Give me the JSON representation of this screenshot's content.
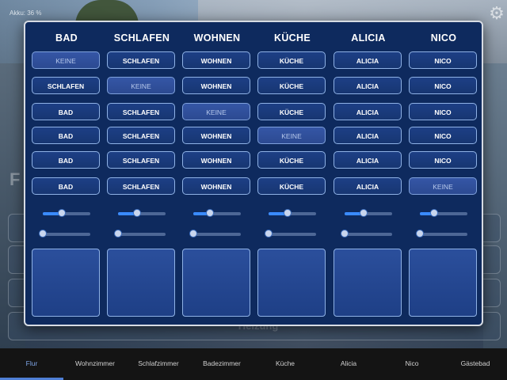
{
  "status": {
    "battery": "Akku: 36 %"
  },
  "icons": {
    "settings": "gear-icon"
  },
  "background": {
    "initial": "F",
    "faded_label": "Heizung"
  },
  "columns": [
    {
      "title": "BAD",
      "buttons": [
        "KEINE",
        "SCHLAFEN",
        "BAD",
        "BAD",
        "BAD",
        "BAD"
      ],
      "selected_index": 0,
      "slider1": 0.4,
      "slider2": 0.0
    },
    {
      "title": "SCHLAFEN",
      "buttons": [
        "SCHLAFEN",
        "KEINE",
        "SCHLAFEN",
        "SCHLAFEN",
        "SCHLAFEN",
        "SCHLAFEN"
      ],
      "selected_index": 1,
      "slider1": 0.4,
      "slider2": 0.0
    },
    {
      "title": "WOHNEN",
      "buttons": [
        "WOHNEN",
        "WOHNEN",
        "KEINE",
        "WOHNEN",
        "WOHNEN",
        "WOHNEN"
      ],
      "selected_index": 2,
      "slider1": 0.35,
      "slider2": 0.0
    },
    {
      "title": "KÜCHE",
      "buttons": [
        "KÜCHE",
        "KÜCHE",
        "KÜCHE",
        "KEINE",
        "KÜCHE",
        "KÜCHE"
      ],
      "selected_index": 3,
      "slider1": 0.4,
      "slider2": 0.0
    },
    {
      "title": "ALICIA",
      "buttons": [
        "ALICIA",
        "ALICIA",
        "ALICIA",
        "ALICIA",
        "ALICIA",
        "ALICIA"
      ],
      "selected_index": 4,
      "slider1": 0.4,
      "slider2": 0.0
    },
    {
      "title": "NICO",
      "buttons": [
        "NICO",
        "NICO",
        "NICO",
        "NICO",
        "NICO",
        "KEINE"
      ],
      "selected_index": 5,
      "slider1": 0.3,
      "slider2": 0.0
    }
  ],
  "nav": {
    "items": [
      "Flur",
      "Wohnzimmer",
      "Schlafzimmer",
      "Badezimmer",
      "Küche",
      "Alicia",
      "Nico",
      "Gästebad"
    ],
    "active_index": 0
  },
  "colors": {
    "modal_bg": "#0e2a5e",
    "button_border": "#8fb2e6",
    "slider_fill": "#3a8bff",
    "nav_active": "#7fa6e8"
  }
}
